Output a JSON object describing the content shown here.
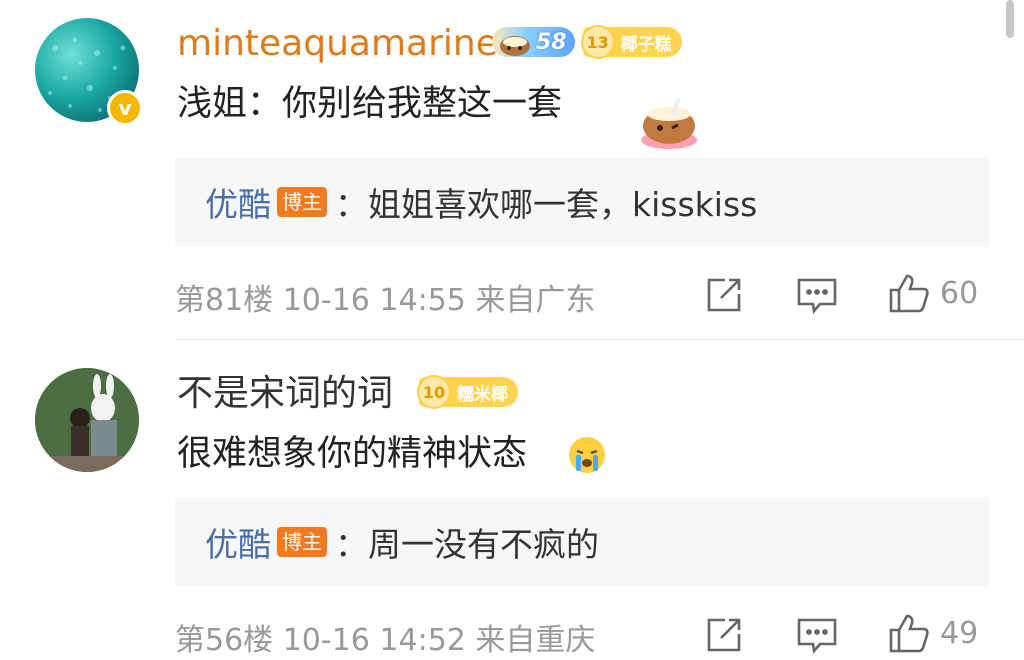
{
  "comments": [
    {
      "username": "minteaquamarine",
      "username_color": "#e07a1a",
      "vip_level": "58",
      "fan_level": "13",
      "fan_title": "椰子糕",
      "text": "浅姐：你别给我整这一套",
      "reply": {
        "name": "优酷",
        "tag": "博主",
        "text": "：姐姐喜欢哪一套，kisskiss"
      },
      "meta": "第81楼 10-16 14:55 来自广东",
      "likes": "60"
    },
    {
      "username": "不是宋词的词",
      "username_color": "#333333",
      "fan_level": "10",
      "fan_title": "糯米椰",
      "text": "很难想象你的精神状态",
      "reply": {
        "name": "优酷",
        "tag": "博主",
        "text": "：周一没有不疯的"
      },
      "meta": "第56楼 10-16 14:52 来自重庆",
      "likes": "49"
    }
  ],
  "icons": {
    "share": "share-icon",
    "comment": "comment-icon",
    "like": "like-icon",
    "verified": "verified-icon",
    "emoji_coconut": "coconut-emoji-icon",
    "emoji_cry": "crying-emoji-icon"
  }
}
